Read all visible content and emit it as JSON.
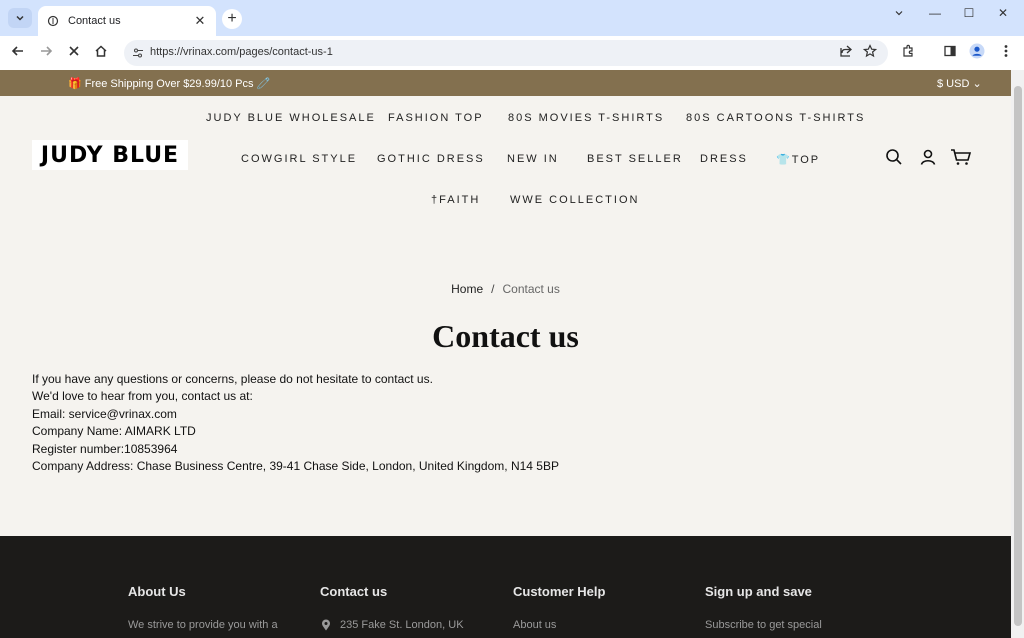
{
  "browser": {
    "tab_title": "Contact us",
    "url": "https://vrinax.com/pages/contact-us-1",
    "win_minimize": "—",
    "win_maximize": "☐",
    "win_close": "✕",
    "new_tab": "+",
    "tab_close": "✕"
  },
  "announcement": {
    "message": "🎁 Free Shipping Over $29.99/10 Pcs 🧷",
    "currency": "$ USD ⌄"
  },
  "header": {
    "logo": "JUDY BLUE",
    "nav": [
      "JUDY BLUE WHOLESALE",
      "FASHION TOP",
      "80S MOVIES T-SHIRTS",
      "80S CARTOONS T-SHIRTS",
      "COWGIRL STYLE",
      "GOTHIC DRESS",
      "NEW IN",
      "BEST SELLER",
      "DRESS",
      "👕TOP",
      "†FAITH",
      "WWE COLLECTION"
    ]
  },
  "breadcrumb": {
    "home": "Home",
    "separator": "/",
    "current": "Contact us"
  },
  "page": {
    "title": "Contact us",
    "lines": [
      "If you have any questions or concerns, please do not hesitate to contact us.",
      "We'd love to hear from you, contact us at:",
      "Email: service@vrinax.com",
      "Company Name: AIMARK LTD",
      "Register number:10853964",
      "Company Address: Chase Business Centre, 39-41 Chase Side, London, United Kingdom, N14 5BP"
    ]
  },
  "footer": {
    "columns": [
      {
        "heading": "About Us",
        "text": "We strive to provide you with a"
      },
      {
        "heading": "Contact us",
        "text": "235 Fake St. London, UK"
      },
      {
        "heading": "Customer Help",
        "text": "About us"
      },
      {
        "heading": "Sign up and save",
        "text": "Subscribe to get special"
      }
    ]
  },
  "colors": {
    "announcement_bg": "#83704f",
    "page_bg": "#f5f3ef",
    "footer_bg": "#1c1b19",
    "tabstrip_bg": "#d3e3fd"
  }
}
